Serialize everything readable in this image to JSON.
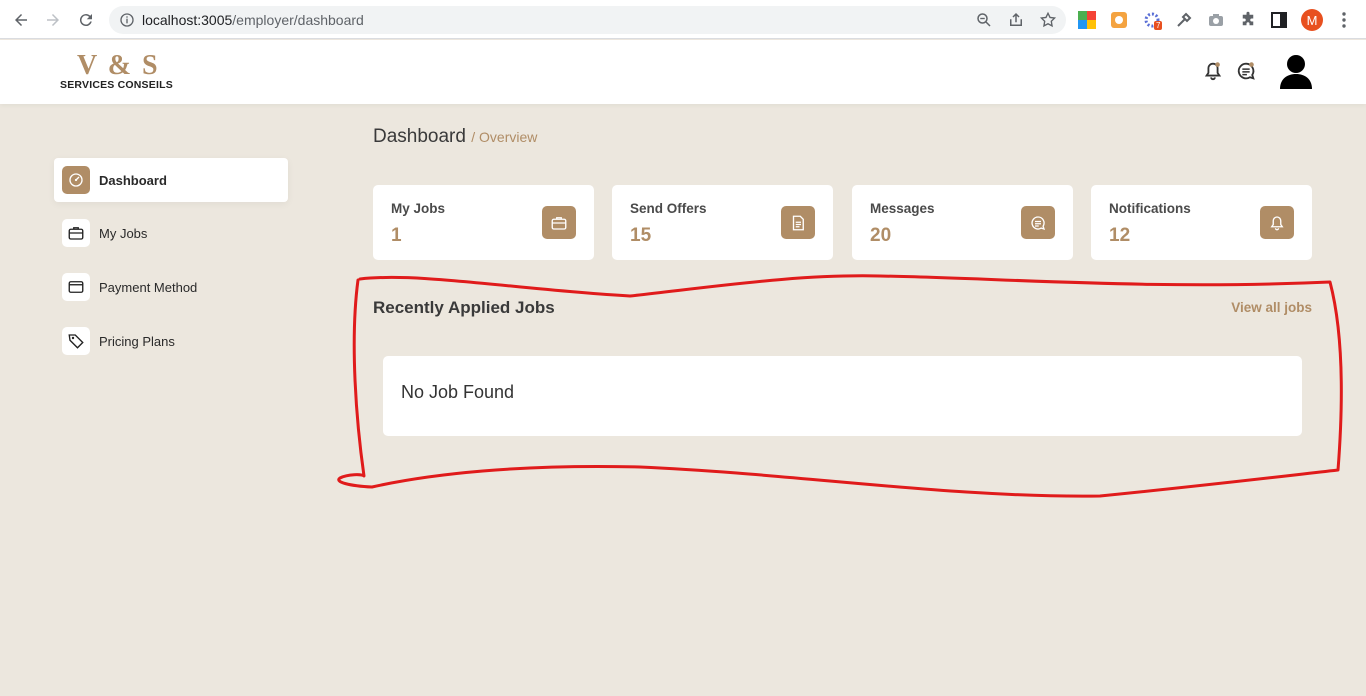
{
  "browser": {
    "url_host": "localhost:3005",
    "url_path": "/employer/dashboard",
    "profile_initial": "M",
    "extension_badge": "7"
  },
  "brand": {
    "logo_main": "V & S",
    "logo_sub": "SERVICES CONSEILS",
    "accent": "#b08d66",
    "background": "#ece7de"
  },
  "sidebar": {
    "items": [
      {
        "label": "Dashboard",
        "icon": "speedometer-icon",
        "active": true
      },
      {
        "label": "My Jobs",
        "icon": "briefcase-icon",
        "active": false
      },
      {
        "label": "Payment Method",
        "icon": "credit-card-icon",
        "active": false
      },
      {
        "label": "Pricing Plans",
        "icon": "price-tag-icon",
        "active": false
      }
    ]
  },
  "breadcrumb": {
    "title": "Dashboard",
    "sub": "/ Overview"
  },
  "stats": [
    {
      "title": "My Jobs",
      "value": "1",
      "icon": "briefcase-icon"
    },
    {
      "title": "Send Offers",
      "value": "15",
      "icon": "document-icon"
    },
    {
      "title": "Messages",
      "value": "20",
      "icon": "message-icon"
    },
    {
      "title": "Notifications",
      "value": "12",
      "icon": "bell-icon"
    }
  ],
  "recent": {
    "title": "Recently Applied Jobs",
    "view_all": "View all jobs",
    "empty_text": "No Job Found"
  },
  "annotation": {
    "color": "#e01b1b"
  }
}
